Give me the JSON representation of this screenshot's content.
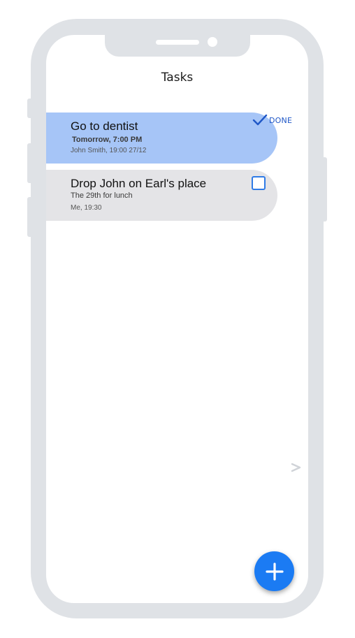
{
  "header": {
    "title": "Tasks"
  },
  "tasks": [
    {
      "title": "Go to dentist",
      "subtitle": "Tomorrow, 7:00 PM",
      "meta": "John Smith, 19:00 27/12",
      "done": true,
      "status_label": "DONE"
    },
    {
      "title": "Drop John on Earl's place",
      "subtitle": "The 29th for lunch",
      "meta": "Me, 19:30",
      "done": false
    }
  ],
  "icons": {
    "done": "checkmark-icon",
    "todo": "empty-checkbox",
    "chevron": "chevron-right-icon",
    "fab": "plus-icon"
  },
  "colors": {
    "done_row": "#a6c5f7",
    "pending_row": "#e4e4e7",
    "accent": "#1b7bf3",
    "frame": "#dfe2e6"
  }
}
